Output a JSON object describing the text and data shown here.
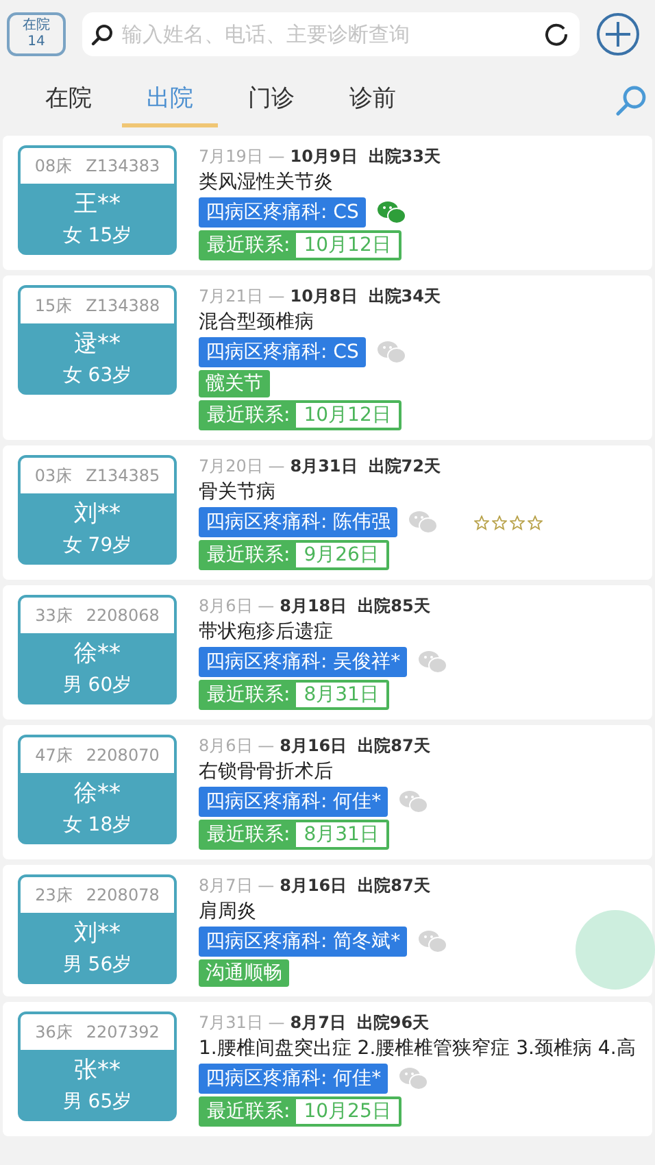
{
  "header": {
    "ward_badge": {
      "label": "在院",
      "count": "14"
    },
    "search": {
      "placeholder": "输入姓名、电话、主要诊断查询"
    }
  },
  "tabs": [
    {
      "label": "在院",
      "selected": false
    },
    {
      "label": "出院",
      "selected": true
    },
    {
      "label": "门诊",
      "selected": false
    },
    {
      "label": "诊前",
      "selected": false
    }
  ],
  "patients": [
    {
      "bed": "08床",
      "id": "Z134383",
      "name": "王**",
      "gender": "女",
      "age": "15岁",
      "admitted": "7月19日 —",
      "discharged": "10月9日",
      "days": "出院33天",
      "diagnosis": "类风湿性关节炎",
      "department": "四病区疼痛科: CS",
      "wechat_linked": true,
      "contact_label": "最近联系:",
      "contact_date": "10月12日"
    },
    {
      "bed": "15床",
      "id": "Z134388",
      "name": "逯**",
      "gender": "女",
      "age": "63岁",
      "admitted": "7月21日 —",
      "discharged": "10月8日",
      "days": "出院34天",
      "diagnosis": "混合型颈椎病",
      "department": "四病区疼痛科: CS",
      "wechat_linked": false,
      "tags": [
        "髋关节"
      ],
      "contact_label": "最近联系:",
      "contact_date": "10月12日"
    },
    {
      "bed": "03床",
      "id": "Z134385",
      "name": "刘**",
      "gender": "女",
      "age": "79岁",
      "admitted": "7月20日 —",
      "discharged": "8月31日",
      "days": "出院72天",
      "diagnosis": "骨关节病",
      "department": "四病区疼痛科: 陈伟强",
      "wechat_linked": false,
      "stars": 0,
      "contact_label": "最近联系:",
      "contact_date": "9月26日"
    },
    {
      "bed": "33床",
      "id": "2208068",
      "name": "徐**",
      "gender": "男",
      "age": "60岁",
      "admitted": "8月6日 —",
      "discharged": "8月18日",
      "days": "出院85天",
      "diagnosis": "带状疱疹后遗症",
      "department": "四病区疼痛科: 吴俊祥*",
      "wechat_linked": false,
      "contact_label": "最近联系:",
      "contact_date": "8月31日"
    },
    {
      "bed": "47床",
      "id": "2208070",
      "name": "徐**",
      "gender": "女",
      "age": "18岁",
      "admitted": "8月6日 —",
      "discharged": "8月16日",
      "days": "出院87天",
      "diagnosis": "右锁骨骨折术后",
      "department": "四病区疼痛科: 何佳*",
      "wechat_linked": false,
      "contact_label": "最近联系:",
      "contact_date": "8月31日"
    },
    {
      "bed": "23床",
      "id": "2208078",
      "name": "刘**",
      "gender": "男",
      "age": "56岁",
      "admitted": "8月7日 —",
      "discharged": "8月16日",
      "days": "出院87天",
      "diagnosis": "肩周炎",
      "department": "四病区疼痛科: 简冬斌*",
      "wechat_linked": false,
      "tags": [
        "沟通顺畅"
      ]
    },
    {
      "bed": "36床",
      "id": "2207392",
      "name": "张**",
      "gender": "男",
      "age": "65岁",
      "admitted": "7月31日 —",
      "discharged": "8月7日",
      "days": "出院96天",
      "diagnosis": "1.腰椎间盘突出症 2.腰椎椎管狭窄症 3.颈椎病 4.高",
      "department": "四病区疼痛科: 何佳*",
      "wechat_linked": false,
      "contact_label": "最近联系:",
      "contact_date": "10月25日"
    }
  ]
}
